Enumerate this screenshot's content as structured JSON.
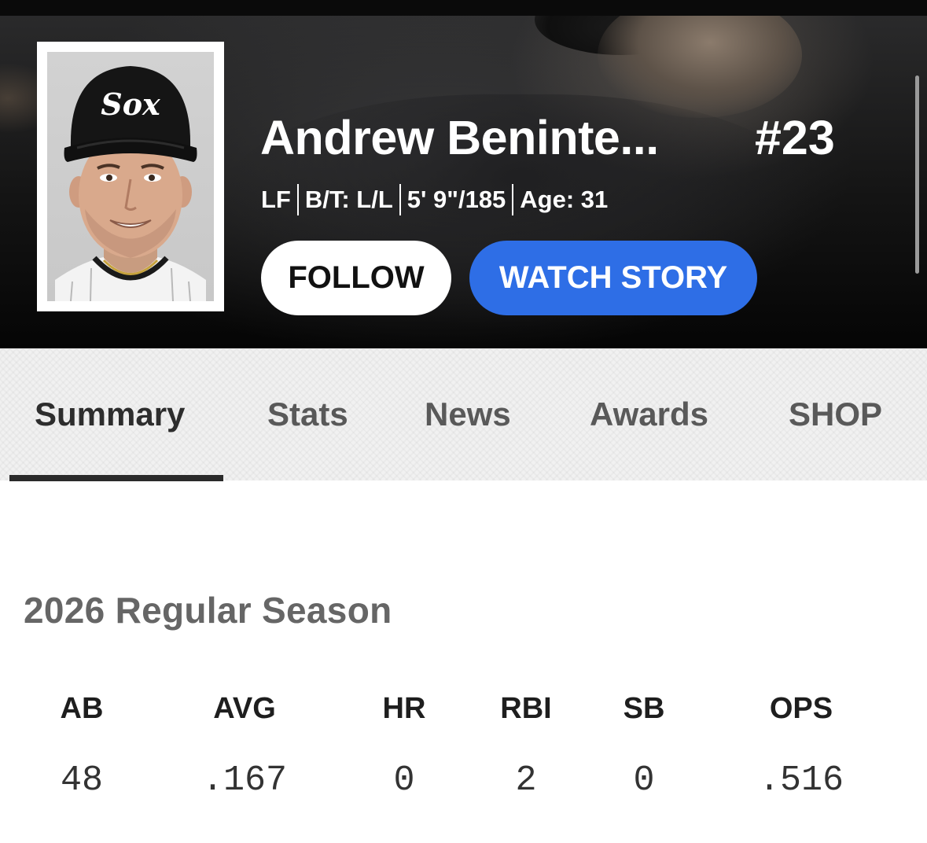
{
  "player": {
    "name": "Andrew Beninte...",
    "number": "#23",
    "position": "LF",
    "bats_throws": "B/T: L/L",
    "height_weight": "5' 9\"/185",
    "age": "Age: 31",
    "cap_logo": "Sox"
  },
  "actions": {
    "follow_label": "FOLLOW",
    "watch_story_label": "WATCH STORY"
  },
  "tabs": [
    {
      "label": "Summary",
      "active": true
    },
    {
      "label": "Stats",
      "active": false
    },
    {
      "label": "News",
      "active": false
    },
    {
      "label": "Awards",
      "active": false
    },
    {
      "label": "SHOP",
      "active": false
    }
  ],
  "season": {
    "title": "2026 Regular Season",
    "stats": [
      {
        "label": "AB",
        "value": "48"
      },
      {
        "label": "AVG",
        "value": ".167"
      },
      {
        "label": "HR",
        "value": "0"
      },
      {
        "label": "RBI",
        "value": "2"
      },
      {
        "label": "SB",
        "value": "0"
      },
      {
        "label": "OPS",
        "value": ".516"
      }
    ]
  },
  "colors": {
    "watch_button": "#2e6ee6",
    "hero_background": "#141414",
    "tab_background": "#f1f1f1",
    "active_tab_underline": "#2a2a2a"
  }
}
